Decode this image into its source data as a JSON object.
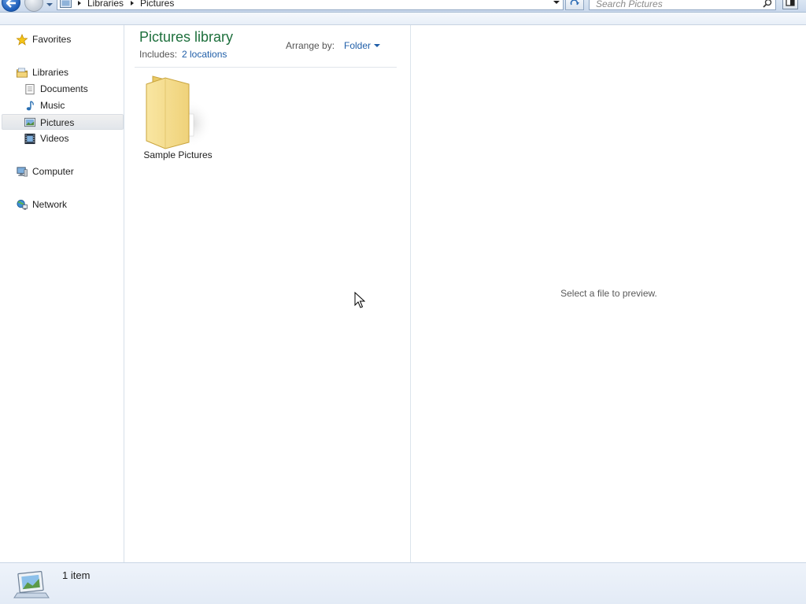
{
  "address_bar": {
    "breadcrumb": [
      "Libraries",
      "Pictures"
    ],
    "search_placeholder": "Search Pictures"
  },
  "nav_pane": {
    "favorites": "Favorites",
    "libraries": "Libraries",
    "library_items": [
      "Documents",
      "Music",
      "Pictures",
      "Videos"
    ],
    "selected": "Pictures",
    "computer": "Computer",
    "network": "Network"
  },
  "content": {
    "title": "Pictures library",
    "includes_label": "Includes:",
    "includes_link": "2 locations",
    "arrange_label": "Arrange by:",
    "arrange_value": "Folder",
    "items": [
      {
        "name": "Sample Pictures",
        "icon": "folder-icon"
      }
    ]
  },
  "preview": {
    "message": "Select a file to preview."
  },
  "details": {
    "item_count": "1 item"
  },
  "colors": {
    "title_green": "#1d6f3c",
    "link_blue": "#1f5ea8",
    "selection_gray": "#e2e6eb"
  }
}
